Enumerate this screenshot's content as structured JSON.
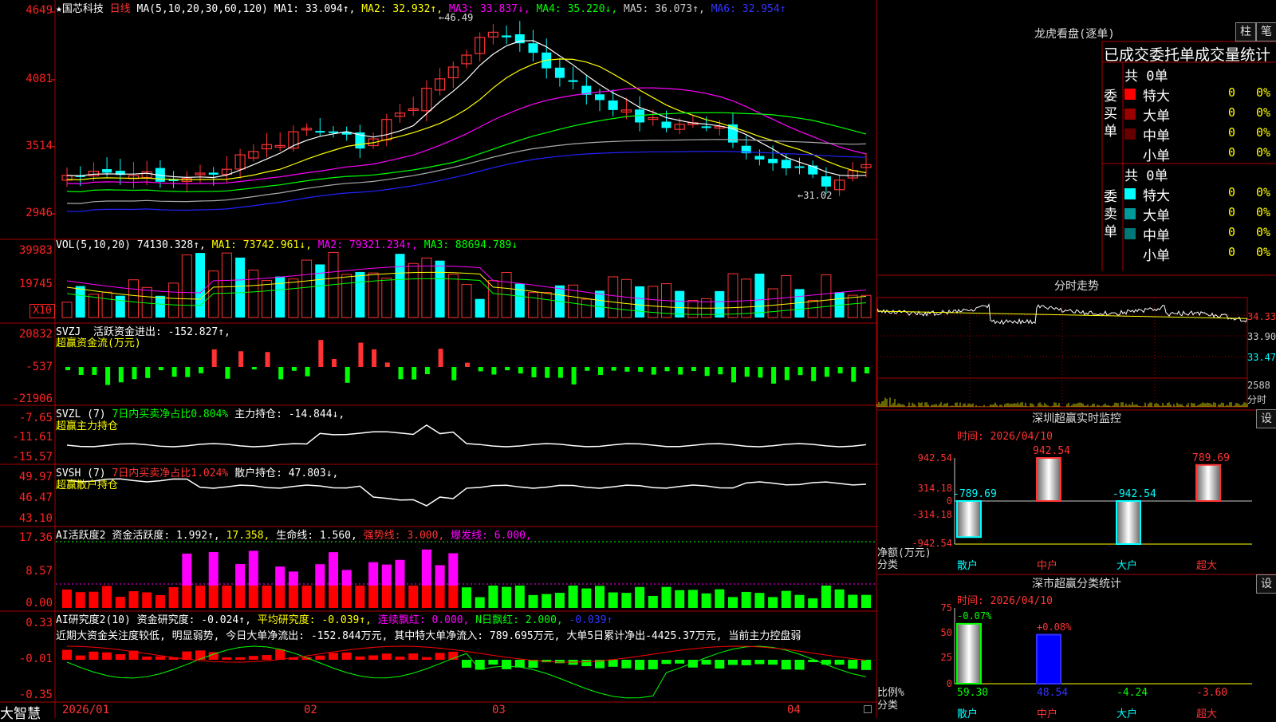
{
  "header": {
    "star": "★",
    "stock_name": "国芯科技",
    "period": "日线",
    "ma_label": "MA(5,10,20,30,60,120)",
    "ma1": "MA1: 33.094↑,",
    "ma2": "MA2: 32.932↑,",
    "ma3": "MA3: 33.837↓,",
    "ma4": "MA4: 35.220↓,",
    "ma5": "MA5: 36.073↑,",
    "ma6": "MA6: 32.954↑",
    "high_mark": "46.49",
    "low_mark": "31.02"
  },
  "price_axis": [
    "4649",
    "4081",
    "3514",
    "2946"
  ],
  "vol": {
    "label": "VOL(5,10,20)",
    "v": "74130.328↑,",
    "ma1": "MA1: 73742.961↓,",
    "ma2": "MA2: 79321.234↑,",
    "ma3": "MA3: 88694.789↓",
    "axis": [
      "39983",
      "19745"
    ],
    "unit": "X10"
  },
  "svzj": {
    "label": "SVZJ",
    "text": "活跃资金进出: -152.827↑,",
    "sub": "超赢资金流(万元)",
    "axis": [
      "20832",
      "-537",
      "-21906"
    ]
  },
  "svzl": {
    "label": "SVZL (7)",
    "text1": "7日内买卖净占比0.804%",
    "text2": "主力持仓: -14.844↓,",
    "sub": "超赢主力持仓",
    "axis": [
      "-7.65",
      "-11.61",
      "-15.57"
    ]
  },
  "svsh": {
    "label": "SVSH (7)",
    "text1": "7日内买卖净占比1.024%",
    "text2": "散户持仓: 47.803↓,",
    "sub": "超赢散户持仓",
    "axis": [
      "49.97",
      "46.47",
      "43.10"
    ]
  },
  "ai1": {
    "label": "AI活跃度2",
    "t1": "资金活跃度: 1.992↑,",
    "t2": "17.358,",
    "t3": "生命线: 1.560,",
    "t4": "强势线: 3.000,",
    "t5": "爆发线: 6.000,",
    "axis": [
      "17.36",
      "8.57",
      "0.00"
    ]
  },
  "ai2": {
    "label": "AI研究度2(10)",
    "t1": "资金研究度: -0.024↑,",
    "t2": "平均研究度: -0.039↑,",
    "t3": "连续飘红: 0.000,",
    "t4": "N日飘红: 2.000,",
    "t5": "-0.039↑",
    "comment": "近期大资金关注度较低, 明显弱势, 今日大单净流出: -152.844万元, 其中特大单净流入: 789.695万元, 大单5日累计净出-4425.37万元, 当前主力控盘弱",
    "axis": [
      "0.33",
      "-0.01",
      "-0.35"
    ]
  },
  "date_axis": [
    "2026/01",
    "02",
    "03",
    "04"
  ],
  "logo": "大智慧",
  "lhb": {
    "title": "龙虎看盘(逐单)",
    "btn1": "柱",
    "btn2": "笔",
    "subtitle": "已成交委托单成交量统计",
    "buy_total": "共 0单",
    "buy_label": "委买单",
    "sell_total": "共 0单",
    "sell_label": "委卖单",
    "buy_rows": [
      {
        "name": "特大",
        "count": "0",
        "pct": "0%",
        "color": "#ff0000"
      },
      {
        "name": "大单",
        "count": "0",
        "pct": "0%",
        "color": "#990000"
      },
      {
        "name": "中单",
        "count": "0",
        "pct": "0%",
        "color": "#660000"
      },
      {
        "name": "小单",
        "count": "0",
        "pct": "0%",
        "color": "#000000"
      }
    ],
    "sell_rows": [
      {
        "name": "特大",
        "count": "0",
        "pct": "0%",
        "color": "#00ffff"
      },
      {
        "name": "大单",
        "count": "0",
        "pct": "0%",
        "color": "#009999"
      },
      {
        "name": "中单",
        "count": "0",
        "pct": "0%",
        "color": "#007777"
      },
      {
        "name": "小单",
        "count": "0",
        "pct": "0%",
        "color": "#000000"
      }
    ]
  },
  "intraday": {
    "title": "分时走势",
    "axis": [
      "34.33",
      "33.90",
      "33.47"
    ],
    "vol_axis": "2588",
    "vol_unit": "分时"
  },
  "sz_monitor": {
    "title": "深圳超赢实时监控",
    "btn": "设",
    "time": "时间: 2026/04/10",
    "axis": [
      "942.54",
      "314.18",
      "0",
      "-314.18",
      "-942.54"
    ],
    "unit1": "净额(万元)",
    "unit2": "分类",
    "categories": [
      "散户",
      "中户",
      "大户",
      "超大"
    ],
    "values": [
      -789.69,
      942.54,
      -942.54,
      789.69
    ],
    "labels": [
      "-789.69",
      "942.54",
      "-942.54",
      "789.69"
    ]
  },
  "sz_class": {
    "title": "深市超赢分类统计",
    "btn": "设",
    "time": "时间: 2026/04/10",
    "axis": [
      "75",
      "50",
      "25",
      "0"
    ],
    "unit1": "比例%",
    "unit2": "分类",
    "categories": [
      "散户",
      "中户",
      "大户",
      "超大"
    ],
    "top_labels": [
      "-0.07%",
      "+0.08%"
    ],
    "values": [
      59.3,
      48.54,
      -4.24,
      -3.6
    ],
    "labels": [
      "59.30",
      "48.54",
      "-4.24",
      "-3.60"
    ]
  },
  "colors": {
    "up": "#ff3333",
    "down": "#00ffff",
    "ma1": "#ffffff",
    "ma2": "#ffff00",
    "ma3": "#ff00ff",
    "ma4": "#00ff00",
    "ma5": "#aaaaaa",
    "ma6": "#2222ff",
    "grid": "#aa0000"
  }
}
